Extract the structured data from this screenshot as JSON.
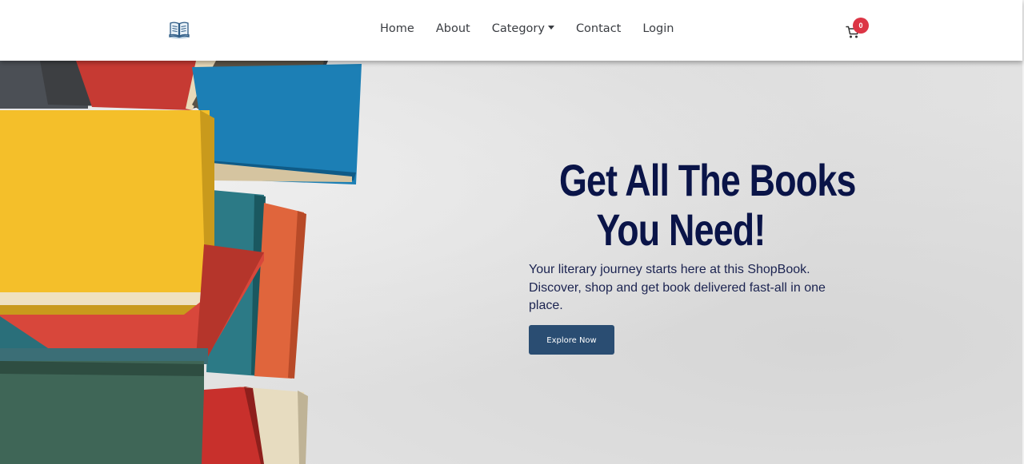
{
  "brand": {
    "logo_icon": "open-book-icon"
  },
  "nav": {
    "items": [
      {
        "label": "Home"
      },
      {
        "label": "About"
      },
      {
        "label": "Category"
      },
      {
        "label": "Contact"
      },
      {
        "label": "Login"
      }
    ]
  },
  "cart": {
    "icon": "cart-icon",
    "count": "0"
  },
  "hero": {
    "title_line1": "Get All The Books",
    "title_line2": "You Need!",
    "description": "Your literary journey starts here at this ShopBook. Discover, shop and get book delivered fast-all in one place.",
    "button_label": "Explore Now"
  },
  "colors": {
    "primary_button": "#2a4d72",
    "title": "#0a1448",
    "badge": "#dc3545"
  }
}
